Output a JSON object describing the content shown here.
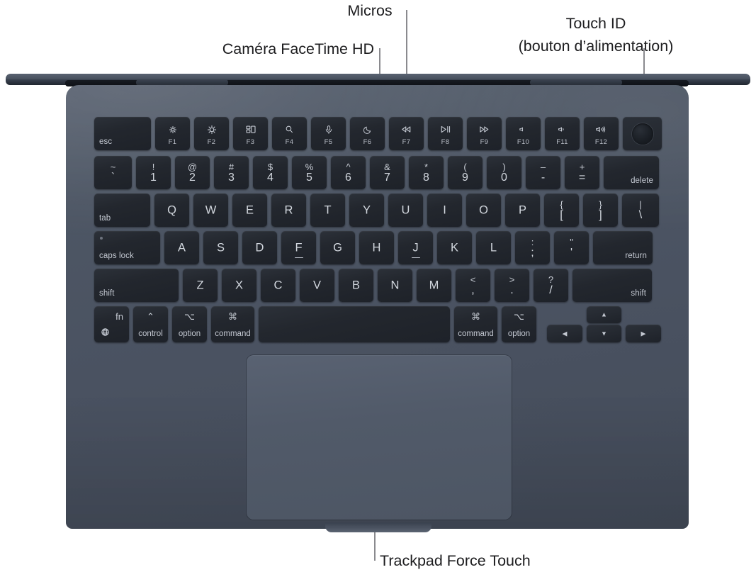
{
  "figure": {
    "title": "MacBook Air vue de dessus avec légendes",
    "device_color_hex": "#4a5261",
    "key_color_hex": "#23272e",
    "label_color_hex": "#1d1d1f",
    "leader_color_hex": "#8a8a8e"
  },
  "callouts": [
    {
      "id": "camera",
      "text": "Caméra FaceTime HD"
    },
    {
      "id": "mics",
      "text": "Micros"
    },
    {
      "id": "touchid1",
      "text": "Touch ID"
    },
    {
      "id": "touchid2",
      "text": "(bouton d’alimentation)"
    },
    {
      "id": "trackpad",
      "text": "Trackpad Force Touch"
    }
  ],
  "keyboard": {
    "function_row": [
      {
        "name": "esc",
        "corner": "esc"
      },
      {
        "name": "f1",
        "icon": "brightness-down-icon",
        "fn": "F1"
      },
      {
        "name": "f2",
        "icon": "brightness-up-icon",
        "fn": "F2"
      },
      {
        "name": "f3",
        "icon": "mission-control-icon",
        "fn": "F3"
      },
      {
        "name": "f4",
        "icon": "spotlight-search-icon",
        "fn": "F4"
      },
      {
        "name": "f5",
        "icon": "dictation-mic-icon",
        "fn": "F5"
      },
      {
        "name": "f6",
        "icon": "do-not-disturb-moon-icon",
        "fn": "F6"
      },
      {
        "name": "f7",
        "icon": "rewind-icon",
        "fn": "F7"
      },
      {
        "name": "f8",
        "icon": "play-pause-icon",
        "fn": "F8"
      },
      {
        "name": "f9",
        "icon": "fast-forward-icon",
        "fn": "F9"
      },
      {
        "name": "f10",
        "icon": "volume-mute-icon",
        "fn": "F10"
      },
      {
        "name": "f11",
        "icon": "volume-down-icon",
        "fn": "F11"
      },
      {
        "name": "f12",
        "icon": "volume-up-icon",
        "fn": "F12"
      },
      {
        "name": "touch-id",
        "icon": "touch-id-icon"
      }
    ],
    "number_row": [
      {
        "name": "grave",
        "upper": "~",
        "lower": "`"
      },
      {
        "name": "1",
        "upper": "!",
        "lower": "1"
      },
      {
        "name": "2",
        "upper": "@",
        "lower": "2"
      },
      {
        "name": "3",
        "upper": "#",
        "lower": "3"
      },
      {
        "name": "4",
        "upper": "$",
        "lower": "4"
      },
      {
        "name": "5",
        "upper": "%",
        "lower": "5"
      },
      {
        "name": "6",
        "upper": "^",
        "lower": "6"
      },
      {
        "name": "7",
        "upper": "&",
        "lower": "7"
      },
      {
        "name": "8",
        "upper": "*",
        "lower": "8"
      },
      {
        "name": "9",
        "upper": "(",
        "lower": "9"
      },
      {
        "name": "0",
        "upper": ")",
        "lower": "0"
      },
      {
        "name": "minus",
        "upper": "–",
        "lower": "-"
      },
      {
        "name": "equal",
        "upper": "+",
        "lower": "="
      },
      {
        "name": "delete",
        "corner": "delete"
      }
    ],
    "top_row": [
      {
        "name": "tab",
        "corner": "tab"
      },
      {
        "name": "q",
        "single": "Q"
      },
      {
        "name": "w",
        "single": "W"
      },
      {
        "name": "e",
        "single": "E"
      },
      {
        "name": "r",
        "single": "R"
      },
      {
        "name": "t",
        "single": "T"
      },
      {
        "name": "y",
        "single": "Y"
      },
      {
        "name": "u",
        "single": "U"
      },
      {
        "name": "i",
        "single": "I"
      },
      {
        "name": "o",
        "single": "O"
      },
      {
        "name": "p",
        "single": "P"
      },
      {
        "name": "bracket-left",
        "upper": "{",
        "lower": "["
      },
      {
        "name": "bracket-right",
        "upper": "}",
        "lower": "]"
      },
      {
        "name": "backslash",
        "upper": "|",
        "lower": "\\"
      }
    ],
    "home_row": [
      {
        "name": "caps-lock",
        "corner": "caps lock"
      },
      {
        "name": "a",
        "single": "A"
      },
      {
        "name": "s",
        "single": "S"
      },
      {
        "name": "d",
        "single": "D"
      },
      {
        "name": "f",
        "single": "F",
        "homing": true
      },
      {
        "name": "g",
        "single": "G"
      },
      {
        "name": "h",
        "single": "H"
      },
      {
        "name": "j",
        "single": "J",
        "homing": true
      },
      {
        "name": "k",
        "single": "K"
      },
      {
        "name": "l",
        "single": "L"
      },
      {
        "name": "semicolon",
        "upper": ":",
        "lower": ";"
      },
      {
        "name": "quote",
        "upper": "\"",
        "lower": "'"
      },
      {
        "name": "return",
        "corner": "return"
      }
    ],
    "bottom_letter_row": [
      {
        "name": "shift-left",
        "corner": "shift"
      },
      {
        "name": "z",
        "single": "Z"
      },
      {
        "name": "x",
        "single": "X"
      },
      {
        "name": "c",
        "single": "C"
      },
      {
        "name": "v",
        "single": "V"
      },
      {
        "name": "b",
        "single": "B"
      },
      {
        "name": "n",
        "single": "N"
      },
      {
        "name": "m",
        "single": "M"
      },
      {
        "name": "comma",
        "upper": "<",
        "lower": ","
      },
      {
        "name": "period",
        "upper": ">",
        "lower": "."
      },
      {
        "name": "slash",
        "upper": "?",
        "lower": "/"
      },
      {
        "name": "shift-right",
        "corner": "shift"
      }
    ],
    "modifier_row": [
      {
        "name": "fn-globe",
        "top": "fn",
        "icon": "globe-icon"
      },
      {
        "name": "control-left",
        "top": "⌃",
        "bottom": "control"
      },
      {
        "name": "option-left",
        "top": "⌥",
        "bottom": "option"
      },
      {
        "name": "command-left",
        "top": "⌘",
        "bottom": "command"
      },
      {
        "name": "space",
        "top": "",
        "bottom": ""
      },
      {
        "name": "command-right",
        "top": "⌘",
        "bottom": "command"
      },
      {
        "name": "option-right",
        "top": "⌥",
        "bottom": "option"
      }
    ],
    "arrow_keys": [
      {
        "name": "arrow-left",
        "glyph": "◀"
      },
      {
        "name": "arrow-up",
        "glyph": "▲"
      },
      {
        "name": "arrow-down",
        "glyph": "▼"
      },
      {
        "name": "arrow-right",
        "glyph": "▶"
      }
    ]
  }
}
